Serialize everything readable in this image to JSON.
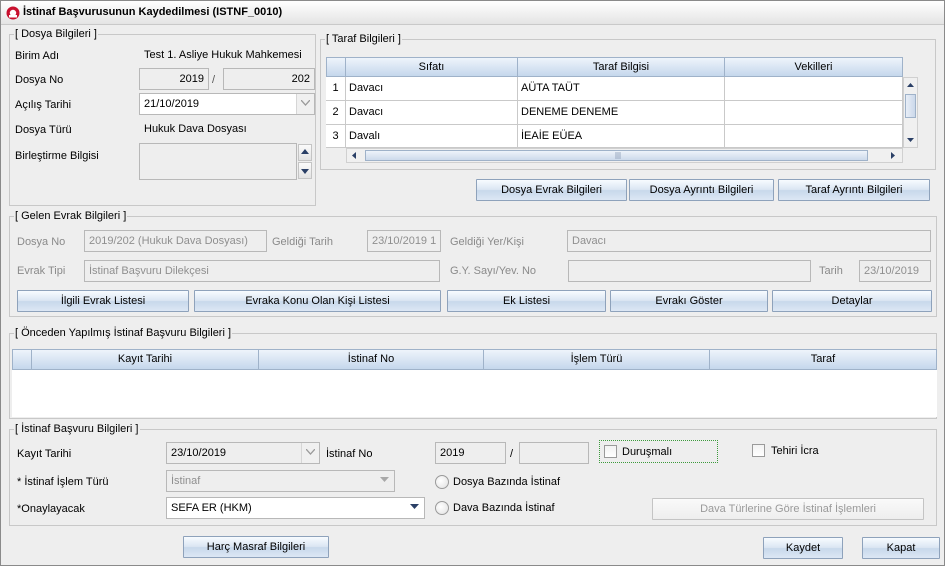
{
  "window": {
    "title": "İstinaf Başvurusunun Kaydedilmesi (ISTNF_0010)"
  },
  "dosya": {
    "title": "[ Dosya Bilgileri ]",
    "birim_label": "Birim Adı",
    "birim_value": "Test 1. Asliye Hukuk Mahkemesi",
    "dosya_no_label": "Dosya No",
    "dosya_yil": "2019",
    "dosya_sep": "/",
    "dosya_sira": "202",
    "acilis_label": "Açılış Tarihi",
    "acilis_value": "21/10/2019",
    "turu_label": "Dosya Türü",
    "turu_value": "Hukuk Dava Dosyası",
    "birlestirme_label": "Birleştirme Bilgisi",
    "birlestirme_value": ""
  },
  "taraf": {
    "title": "[ Taraf Bilgileri ]",
    "columns": [
      "Sıfatı",
      "Taraf Bilgisi",
      "Vekilleri"
    ],
    "rows": [
      {
        "no": "1",
        "sifat": "Davacı",
        "bilgi": "AÜTA TAÜT",
        "vekil": ""
      },
      {
        "no": "2",
        "sifat": "Davacı",
        "bilgi": "DENEME DENEME",
        "vekil": ""
      },
      {
        "no": "3",
        "sifat": "Davalı",
        "bilgi": "İEAİE EÜEA",
        "vekil": ""
      }
    ],
    "buttons": {
      "dosya_evrak": "Dosya Evrak Bilgileri",
      "dosya_ayrinti": "Dosya Ayrıntı Bilgileri",
      "taraf_ayrinti": "Taraf Ayrıntı Bilgileri"
    }
  },
  "gelen": {
    "title": "[ Gelen Evrak Bilgileri ]",
    "dosya_no_label": "Dosya No",
    "dosya_no_value": "2019/202 (Hukuk Dava Dosyası)",
    "geldigi_tarih_label": "Geldiği Tarih",
    "geldigi_tarih_value": "23/10/2019 1",
    "geldigi_yer_label": "Geldiği Yer/Kişi",
    "geldigi_yer_value": "Davacı",
    "evrak_tipi_label": "Evrak Tipi",
    "evrak_tipi_value": "İstinaf Başvuru Dilekçesi",
    "gy_label": "G.Y. Sayı/Yev. No",
    "gy_value": "",
    "tarih_label": "Tarih",
    "tarih_value": "23/10/2019",
    "buttons": {
      "ilgili": "İlgili Evrak Listesi",
      "evraka_konu": "Evraka Konu Olan Kişi Listesi",
      "ek_listesi": "Ek Listesi",
      "evraki_goster": "Evrakı Göster",
      "detaylar": "Detaylar"
    }
  },
  "onceden": {
    "title": "[ Önceden Yapılmış İstinaf Başvuru Bilgileri ]",
    "columns": [
      "Kayıt Tarihi",
      "İstinaf No",
      "İşlem Türü",
      "Taraf"
    ]
  },
  "istinaf": {
    "title": "[ İstinaf Başvuru Bilgileri ]",
    "kayit_label": "Kayıt Tarihi",
    "kayit_value": "23/10/2019",
    "istinaf_no_label": "İstinaf No",
    "istinaf_no_yil": "2019",
    "istinaf_no_sep": "/",
    "istinaf_no_sira": "",
    "durusmali_label": "Duruşmalı",
    "tehiri_label": "Tehiri İcra",
    "islem_turu_label": "* İstinaf İşlem Türü",
    "islem_turu_value": "İstinaf",
    "dosya_bazinda_label": "Dosya Bazında İstinaf",
    "onaylayacak_label": "*Onaylayacak",
    "onaylayacak_value": "SEFA ER (HKM)",
    "dava_bazinda_label": "Dava Bazında İstinaf",
    "dava_turlerine_label": "Dava Türlerine Göre İstinaf İşlemleri"
  },
  "footer": {
    "harc": "Harç Masraf Bilgileri",
    "kaydet": "Kaydet",
    "kapat": "Kapat"
  }
}
